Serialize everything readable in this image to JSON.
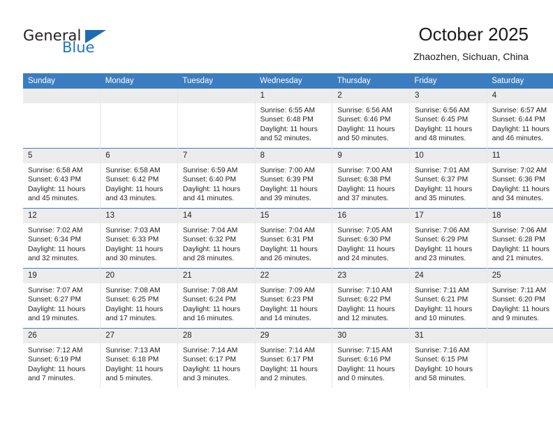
{
  "logo": {
    "word_top": "General",
    "word_bottom": "Blue",
    "accent_color": "#1c6cb4"
  },
  "header": {
    "title": "October 2025",
    "subtitle": "Zhaozhen, Sichuan, China"
  },
  "theme": {
    "header_row_bg": "#3b7dc0",
    "daynum_bg": "#ececec",
    "text_color": "#231f20"
  },
  "weekday_headers": [
    "Sunday",
    "Monday",
    "Tuesday",
    "Wednesday",
    "Thursday",
    "Friday",
    "Saturday"
  ],
  "weeks": [
    [
      {
        "day": "",
        "empty": true,
        "lines": []
      },
      {
        "day": "",
        "empty": true,
        "lines": []
      },
      {
        "day": "",
        "empty": true,
        "lines": []
      },
      {
        "day": "1",
        "lines": [
          "Sunrise: 6:55 AM",
          "Sunset: 6:48 PM",
          "Daylight: 11 hours",
          "and 52 minutes."
        ]
      },
      {
        "day": "2",
        "lines": [
          "Sunrise: 6:56 AM",
          "Sunset: 6:46 PM",
          "Daylight: 11 hours",
          "and 50 minutes."
        ]
      },
      {
        "day": "3",
        "lines": [
          "Sunrise: 6:56 AM",
          "Sunset: 6:45 PM",
          "Daylight: 11 hours",
          "and 48 minutes."
        ]
      },
      {
        "day": "4",
        "lines": [
          "Sunrise: 6:57 AM",
          "Sunset: 6:44 PM",
          "Daylight: 11 hours",
          "and 46 minutes."
        ]
      }
    ],
    [
      {
        "day": "5",
        "lines": [
          "Sunrise: 6:58 AM",
          "Sunset: 6:43 PM",
          "Daylight: 11 hours",
          "and 45 minutes."
        ]
      },
      {
        "day": "6",
        "lines": [
          "Sunrise: 6:58 AM",
          "Sunset: 6:42 PM",
          "Daylight: 11 hours",
          "and 43 minutes."
        ]
      },
      {
        "day": "7",
        "lines": [
          "Sunrise: 6:59 AM",
          "Sunset: 6:40 PM",
          "Daylight: 11 hours",
          "and 41 minutes."
        ]
      },
      {
        "day": "8",
        "lines": [
          "Sunrise: 7:00 AM",
          "Sunset: 6:39 PM",
          "Daylight: 11 hours",
          "and 39 minutes."
        ]
      },
      {
        "day": "9",
        "lines": [
          "Sunrise: 7:00 AM",
          "Sunset: 6:38 PM",
          "Daylight: 11 hours",
          "and 37 minutes."
        ]
      },
      {
        "day": "10",
        "lines": [
          "Sunrise: 7:01 AM",
          "Sunset: 6:37 PM",
          "Daylight: 11 hours",
          "and 35 minutes."
        ]
      },
      {
        "day": "11",
        "lines": [
          "Sunrise: 7:02 AM",
          "Sunset: 6:36 PM",
          "Daylight: 11 hours",
          "and 34 minutes."
        ]
      }
    ],
    [
      {
        "day": "12",
        "lines": [
          "Sunrise: 7:02 AM",
          "Sunset: 6:34 PM",
          "Daylight: 11 hours",
          "and 32 minutes."
        ]
      },
      {
        "day": "13",
        "lines": [
          "Sunrise: 7:03 AM",
          "Sunset: 6:33 PM",
          "Daylight: 11 hours",
          "and 30 minutes."
        ]
      },
      {
        "day": "14",
        "lines": [
          "Sunrise: 7:04 AM",
          "Sunset: 6:32 PM",
          "Daylight: 11 hours",
          "and 28 minutes."
        ]
      },
      {
        "day": "15",
        "lines": [
          "Sunrise: 7:04 AM",
          "Sunset: 6:31 PM",
          "Daylight: 11 hours",
          "and 26 minutes."
        ]
      },
      {
        "day": "16",
        "lines": [
          "Sunrise: 7:05 AM",
          "Sunset: 6:30 PM",
          "Daylight: 11 hours",
          "and 24 minutes."
        ]
      },
      {
        "day": "17",
        "lines": [
          "Sunrise: 7:06 AM",
          "Sunset: 6:29 PM",
          "Daylight: 11 hours",
          "and 23 minutes."
        ]
      },
      {
        "day": "18",
        "lines": [
          "Sunrise: 7:06 AM",
          "Sunset: 6:28 PM",
          "Daylight: 11 hours",
          "and 21 minutes."
        ]
      }
    ],
    [
      {
        "day": "19",
        "lines": [
          "Sunrise: 7:07 AM",
          "Sunset: 6:27 PM",
          "Daylight: 11 hours",
          "and 19 minutes."
        ]
      },
      {
        "day": "20",
        "lines": [
          "Sunrise: 7:08 AM",
          "Sunset: 6:25 PM",
          "Daylight: 11 hours",
          "and 17 minutes."
        ]
      },
      {
        "day": "21",
        "lines": [
          "Sunrise: 7:08 AM",
          "Sunset: 6:24 PM",
          "Daylight: 11 hours",
          "and 16 minutes."
        ]
      },
      {
        "day": "22",
        "lines": [
          "Sunrise: 7:09 AM",
          "Sunset: 6:23 PM",
          "Daylight: 11 hours",
          "and 14 minutes."
        ]
      },
      {
        "day": "23",
        "lines": [
          "Sunrise: 7:10 AM",
          "Sunset: 6:22 PM",
          "Daylight: 11 hours",
          "and 12 minutes."
        ]
      },
      {
        "day": "24",
        "lines": [
          "Sunrise: 7:11 AM",
          "Sunset: 6:21 PM",
          "Daylight: 11 hours",
          "and 10 minutes."
        ]
      },
      {
        "day": "25",
        "lines": [
          "Sunrise: 7:11 AM",
          "Sunset: 6:20 PM",
          "Daylight: 11 hours",
          "and 9 minutes."
        ]
      }
    ],
    [
      {
        "day": "26",
        "lines": [
          "Sunrise: 7:12 AM",
          "Sunset: 6:19 PM",
          "Daylight: 11 hours",
          "and 7 minutes."
        ]
      },
      {
        "day": "27",
        "lines": [
          "Sunrise: 7:13 AM",
          "Sunset: 6:18 PM",
          "Daylight: 11 hours",
          "and 5 minutes."
        ]
      },
      {
        "day": "28",
        "lines": [
          "Sunrise: 7:14 AM",
          "Sunset: 6:17 PM",
          "Daylight: 11 hours",
          "and 3 minutes."
        ]
      },
      {
        "day": "29",
        "lines": [
          "Sunrise: 7:14 AM",
          "Sunset: 6:17 PM",
          "Daylight: 11 hours",
          "and 2 minutes."
        ]
      },
      {
        "day": "30",
        "lines": [
          "Sunrise: 7:15 AM",
          "Sunset: 6:16 PM",
          "Daylight: 11 hours",
          "and 0 minutes."
        ]
      },
      {
        "day": "31",
        "lines": [
          "Sunrise: 7:16 AM",
          "Sunset: 6:15 PM",
          "Daylight: 10 hours",
          "and 58 minutes."
        ]
      },
      {
        "day": "",
        "empty": true,
        "lines": []
      }
    ]
  ]
}
